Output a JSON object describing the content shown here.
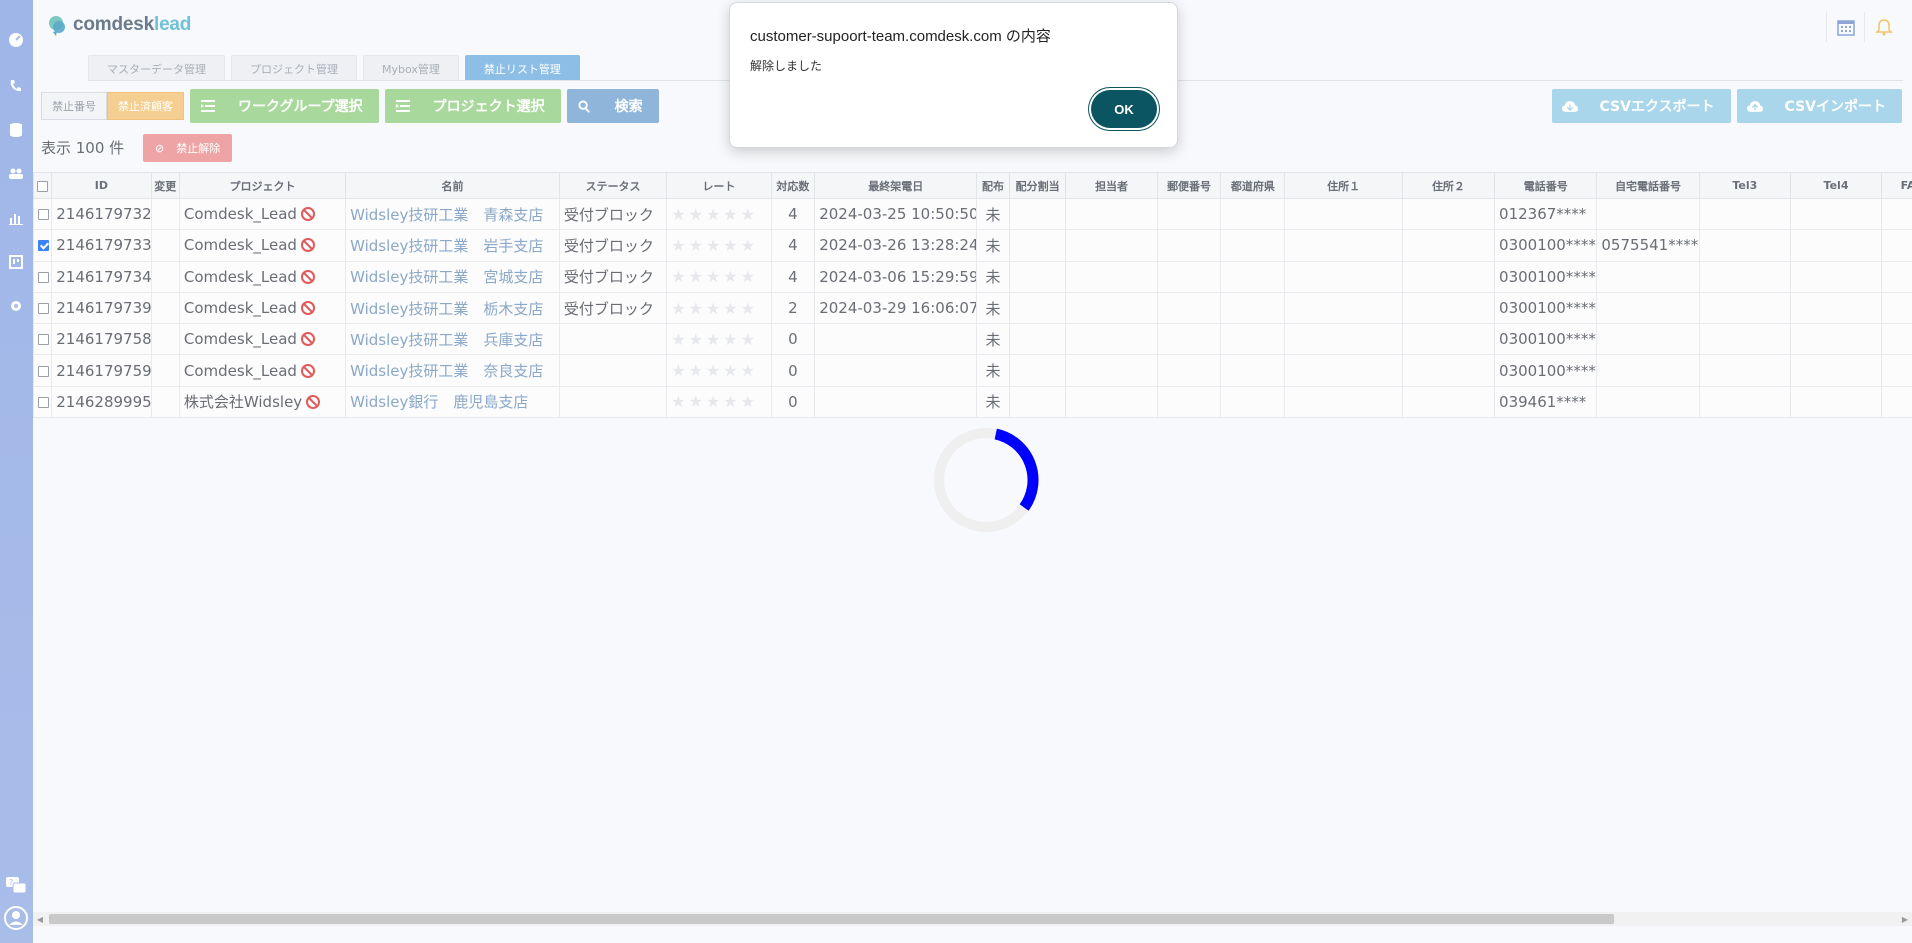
{
  "app": {
    "logo_main": "comdesk",
    "logo_accent": "lead"
  },
  "tabs": [
    "マスターデータ管理",
    "プロジェクト管理",
    "Mybox管理",
    "禁止リスト管理"
  ],
  "active_tab": 3,
  "toolbar": {
    "seg1": "禁止番号",
    "seg2": "禁止済顧客",
    "workgroup": "ワークグループ選択",
    "project": "プロジェクト選択",
    "search": "検索",
    "csv_export": "CSVエクスポート",
    "csv_import": "CSVインポート"
  },
  "count_text": "表示 100 件",
  "unban_label": "禁止解除",
  "columns": [
    "ID",
    "変更",
    "プロジェクト",
    "名前",
    "ステータス",
    "レート",
    "対応数",
    "最終架電日",
    "配布",
    "配分割当",
    "担当者",
    "郵便番号",
    "都道府県",
    "住所１",
    "住所２",
    "電話番号",
    "自宅電話番号",
    "Tel3",
    "Tel4",
    "FA"
  ],
  "rows": [
    {
      "checked": false,
      "id": "2146179732",
      "project": "Comdesk_Lead",
      "name": "Widsley技研工業　青森支店",
      "status": "受付ブロック",
      "count": "4",
      "last_call": "2024-03-25 10:50:50",
      "dist": "未",
      "phone": "012367****",
      "home": ""
    },
    {
      "checked": true,
      "id": "2146179733",
      "project": "Comdesk_Lead",
      "name": "Widsley技研工業　岩手支店",
      "status": "受付ブロック",
      "count": "4",
      "last_call": "2024-03-26 13:28:24",
      "dist": "未",
      "phone": "0300100****",
      "home": "0575541****"
    },
    {
      "checked": false,
      "id": "2146179734",
      "project": "Comdesk_Lead",
      "name": "Widsley技研工業　宮城支店",
      "status": "受付ブロック",
      "count": "4",
      "last_call": "2024-03-06 15:29:59",
      "dist": "未",
      "phone": "0300100****",
      "home": ""
    },
    {
      "checked": false,
      "id": "2146179739",
      "project": "Comdesk_Lead",
      "name": "Widsley技研工業　栃木支店",
      "status": "受付ブロック",
      "count": "2",
      "last_call": "2024-03-29 16:06:07",
      "dist": "未",
      "phone": "0300100****",
      "home": ""
    },
    {
      "checked": false,
      "id": "2146179758",
      "project": "Comdesk_Lead",
      "name": "Widsley技研工業　兵庫支店",
      "status": "",
      "count": "0",
      "last_call": "",
      "dist": "未",
      "phone": "0300100****",
      "home": ""
    },
    {
      "checked": false,
      "id": "2146179759",
      "project": "Comdesk_Lead",
      "name": "Widsley技研工業　奈良支店",
      "status": "",
      "count": "0",
      "last_call": "",
      "dist": "未",
      "phone": "0300100****",
      "home": ""
    },
    {
      "checked": false,
      "id": "2146289995",
      "project": "株式会社Widsley",
      "name": "Widsley銀行　鹿児島支店",
      "status": "",
      "count": "0",
      "last_call": "",
      "dist": "未",
      "phone": "039461****",
      "home": ""
    }
  ],
  "rate_stars": "★★★★★",
  "dialog": {
    "title": "customer-supoort-team.comdesk.com の内容",
    "message": "解除しました",
    "ok": "OK"
  },
  "colors": {
    "sidebar": "#a9bde9",
    "dialog_ok": "#0b5563",
    "spinner": "#0000ff",
    "unban": "#eea4a4"
  },
  "icons": [
    "dashboard-icon",
    "phone-icon",
    "database-icon",
    "users-icon",
    "chart-icon",
    "board-icon",
    "gear-icon",
    "help-chat-icon",
    "user-avatar-icon",
    "calendar-icon",
    "bell-icon"
  ]
}
